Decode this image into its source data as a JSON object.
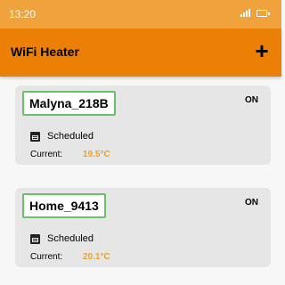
{
  "status_bar": {
    "time": "13:20",
    "signal_icon": "signal-bars-icon",
    "battery_icon": "battery-icon"
  },
  "app_bar": {
    "title": "WiFi Heater",
    "add_icon": "plus-icon",
    "add_label": "+"
  },
  "colors": {
    "status_bar": "#f0a33c",
    "app_bar": "#ec7f05",
    "name_border": "#6cc06a",
    "temperature": "#f0a02a",
    "card_bg": "#e6e6e6"
  },
  "devices": [
    {
      "name": "Malyna_218B",
      "state": "ON",
      "mode": "Scheduled",
      "current_label": "Current:",
      "current_temp": "19.5°C",
      "mode_icon": "calendar-icon"
    },
    {
      "name": "Home_9413",
      "state": "ON",
      "mode": "Scheduled",
      "current_label": "Current:",
      "current_temp": "20.1°C",
      "mode_icon": "calendar-icon"
    }
  ]
}
